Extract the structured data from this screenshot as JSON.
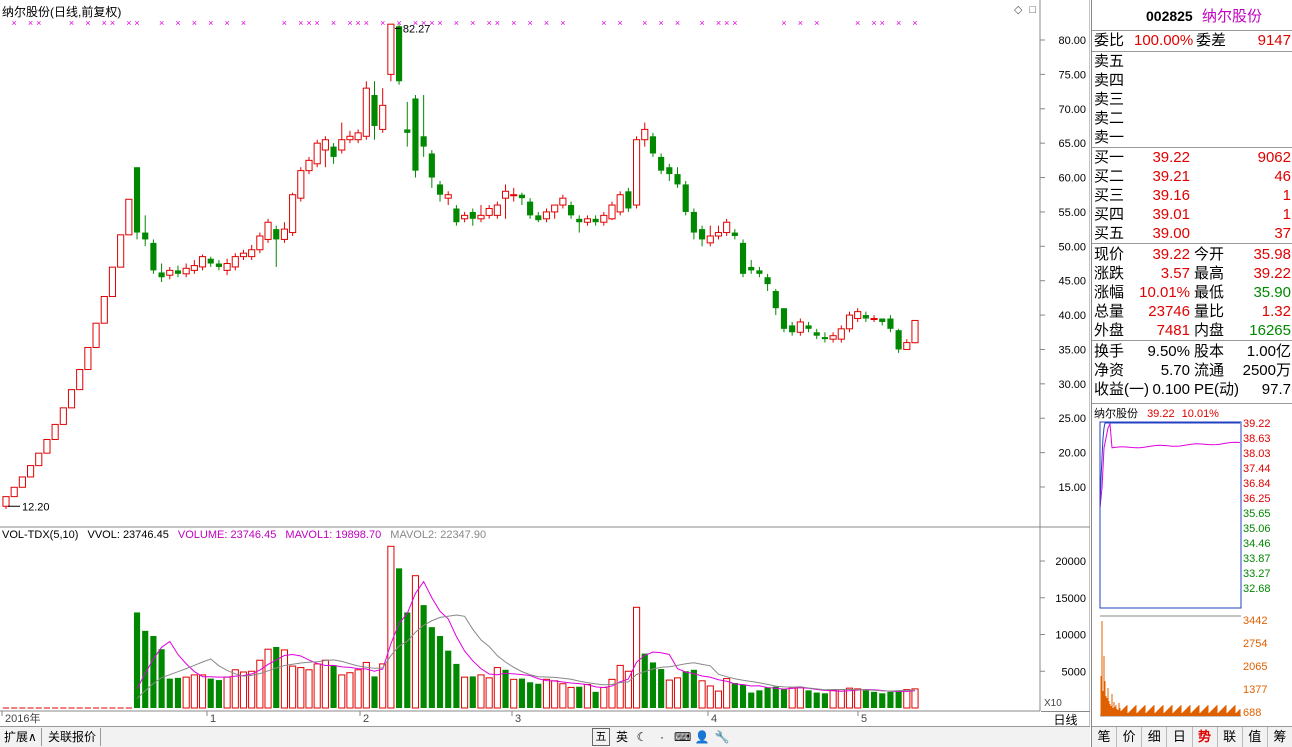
{
  "stock": {
    "code": "002825",
    "name": "纳尔股份",
    "period": "纳尔股份(日线,前复权)"
  },
  "chart_data": {
    "type": "candlestick",
    "y_ticks": [
      "80.00",
      "75.00",
      "70.00",
      "65.00",
      "60.00",
      "55.00",
      "50.00",
      "45.00",
      "40.00",
      "35.00",
      "30.00",
      "25.00",
      "20.00",
      "15.00"
    ],
    "vol_ticks": [
      "20000",
      "15000",
      "10000",
      "5000"
    ],
    "x_labels": [
      "2016年",
      "1",
      "2",
      "3",
      "4",
      "5"
    ],
    "high_label": "82.27",
    "low_label": "12.20",
    "candles": [
      [
        12.2,
        13.6,
        11.8,
        13.6
      ],
      [
        13.6,
        14.96,
        13.6,
        14.96
      ],
      [
        14.96,
        16.46,
        14.96,
        16.46
      ],
      [
        16.46,
        18.11,
        16.46,
        18.11
      ],
      [
        18.11,
        19.92,
        18.11,
        19.92
      ],
      [
        19.92,
        21.91,
        19.92,
        21.91
      ],
      [
        21.91,
        24.1,
        21.91,
        24.1
      ],
      [
        24.1,
        26.51,
        24.1,
        26.51
      ],
      [
        26.51,
        29.16,
        26.51,
        29.16
      ],
      [
        29.16,
        32.08,
        29.16,
        32.08
      ],
      [
        32.08,
        35.29,
        32.08,
        35.29
      ],
      [
        35.29,
        38.82,
        35.29,
        38.82
      ],
      [
        38.82,
        42.7,
        38.82,
        42.7
      ],
      [
        42.7,
        46.97,
        42.7,
        46.97
      ],
      [
        46.97,
        51.67,
        46.97,
        51.67
      ],
      [
        51.67,
        56.84,
        51.67,
        56.84
      ],
      [
        61.5,
        52.0,
        51.0,
        61.5
      ],
      [
        52.0,
        51.0,
        50.0,
        54.5
      ],
      [
        50.5,
        46.5,
        46.0,
        51.0
      ],
      [
        46.2,
        45.5,
        44.8,
        47.5
      ],
      [
        45.8,
        46.5,
        45.2,
        47.0
      ],
      [
        46.5,
        46.0,
        45.5,
        47.2
      ],
      [
        46.0,
        46.8,
        45.5,
        47.5
      ],
      [
        46.5,
        47.2,
        46.0,
        48.0
      ],
      [
        47.0,
        48.5,
        46.5,
        48.8
      ],
      [
        48.2,
        47.5,
        47.0,
        48.5
      ],
      [
        47.5,
        47.0,
        46.5,
        48.0
      ],
      [
        46.5,
        47.5,
        45.8,
        48.2
      ],
      [
        47.0,
        48.5,
        46.5,
        49.0
      ],
      [
        48.5,
        49.0,
        48.0,
        49.5
      ],
      [
        48.5,
        49.5,
        48.0,
        50.2
      ],
      [
        49.5,
        51.5,
        49.0,
        52.0
      ],
      [
        51.0,
        53.5,
        50.5,
        54.0
      ],
      [
        52.5,
        51.0,
        47.0,
        53.0
      ],
      [
        51.0,
        52.5,
        50.5,
        53.5
      ],
      [
        52.0,
        57.5,
        51.5,
        57.8
      ],
      [
        57.0,
        61.0,
        56.5,
        61.5
      ],
      [
        61.0,
        62.5,
        60.5,
        63.0
      ],
      [
        62.0,
        65.0,
        61.5,
        65.5
      ],
      [
        64.0,
        65.5,
        61.5,
        66.0
      ],
      [
        64.5,
        63.0,
        62.0,
        65.0
      ],
      [
        64.0,
        65.5,
        63.5,
        68.0
      ],
      [
        65.5,
        66.0,
        65.0,
        66.8
      ],
      [
        65.5,
        66.5,
        65.0,
        67.0
      ],
      [
        66.0,
        73.0,
        65.5,
        74.0
      ],
      [
        72.0,
        67.5,
        65.5,
        74.0
      ],
      [
        67.0,
        70.5,
        66.5,
        73.0
      ],
      [
        75.0,
        82.3,
        74.0,
        82.3
      ],
      [
        82.0,
        74.0,
        73.5,
        82.27
      ],
      [
        67.0,
        66.5,
        64.5,
        71.0
      ],
      [
        71.5,
        61.0,
        60.0,
        72.0
      ],
      [
        66.0,
        64.5,
        63.0,
        72.0
      ],
      [
        63.5,
        60.0,
        58.5,
        64.0
      ],
      [
        59.0,
        57.5,
        56.5,
        59.5
      ],
      [
        57.0,
        57.5,
        56.0,
        58.0
      ],
      [
        55.5,
        53.5,
        53.0,
        56.0
      ],
      [
        54.0,
        54.5,
        53.5,
        55.0
      ],
      [
        55.0,
        54.0,
        53.0,
        55.5
      ],
      [
        54.0,
        54.5,
        53.5,
        56.0
      ],
      [
        54.5,
        55.5,
        54.0,
        56.0
      ],
      [
        54.5,
        56.0,
        54.0,
        56.5
      ],
      [
        57.0,
        58.0,
        54.0,
        59.0
      ],
      [
        57.5,
        57.5,
        56.5,
        58.5
      ],
      [
        57.5,
        57.0,
        56.0,
        57.8
      ],
      [
        56.5,
        54.5,
        54.0,
        57.0
      ],
      [
        54.5,
        53.8,
        53.5,
        55.0
      ],
      [
        54.0,
        55.0,
        53.5,
        55.5
      ],
      [
        55.0,
        56.0,
        54.0,
        56.0
      ],
      [
        56.0,
        57.0,
        55.5,
        57.5
      ],
      [
        56.0,
        54.5,
        54.0,
        56.5
      ],
      [
        54.0,
        53.5,
        52.0,
        54.5
      ],
      [
        53.5,
        54.0,
        53.0,
        54.5
      ],
      [
        54.0,
        53.5,
        53.0,
        54.5
      ],
      [
        53.5,
        54.5,
        53.0,
        55.0
      ],
      [
        54.0,
        56.0,
        53.8,
        56.5
      ],
      [
        55.0,
        57.5,
        54.5,
        58.0
      ],
      [
        58.0,
        55.5,
        55.0,
        58.5
      ],
      [
        56.0,
        65.5,
        55.5,
        66.0
      ],
      [
        65.5,
        67.0,
        64.5,
        68.0
      ],
      [
        66.0,
        63.5,
        63.0,
        66.5
      ],
      [
        63.0,
        61.0,
        60.5,
        63.5
      ],
      [
        61.5,
        60.5,
        59.5,
        62.0
      ],
      [
        60.5,
        59.0,
        58.5,
        61.5
      ],
      [
        59.0,
        55.0,
        54.5,
        59.5
      ],
      [
        55.0,
        52.0,
        51.0,
        55.5
      ],
      [
        52.5,
        51.0,
        50.0,
        53.0
      ],
      [
        50.5,
        51.5,
        50.0,
        53.0
      ],
      [
        51.5,
        52.0,
        51.0,
        53.0
      ],
      [
        52.0,
        53.5,
        51.5,
        54.0
      ],
      [
        52.0,
        51.5,
        51.0,
        52.5
      ],
      [
        50.5,
        46.0,
        45.5,
        51.0
      ],
      [
        47.0,
        46.5,
        46.0,
        48.0
      ],
      [
        46.5,
        46.0,
        45.5,
        47.0
      ],
      [
        45.5,
        44.5,
        43.5,
        46.0
      ],
      [
        43.5,
        41.0,
        40.0,
        43.8
      ],
      [
        41.0,
        38.0,
        37.5,
        41.0
      ],
      [
        38.5,
        37.5,
        37.0,
        39.0
      ],
      [
        37.5,
        39.0,
        37.0,
        39.5
      ],
      [
        38.5,
        38.0,
        37.5,
        39.0
      ],
      [
        37.5,
        37.0,
        36.5,
        38.0
      ],
      [
        36.8,
        36.5,
        36.0,
        37.5
      ],
      [
        36.5,
        37.0,
        36.0,
        37.5
      ],
      [
        36.5,
        38.0,
        36.0,
        38.5
      ],
      [
        38.0,
        40.0,
        37.5,
        40.5
      ],
      [
        39.5,
        40.5,
        39.0,
        41.0
      ],
      [
        40.0,
        39.5,
        39.0,
        40.5
      ],
      [
        39.5,
        39.5,
        39.0,
        40.0
      ],
      [
        39.5,
        39.0,
        38.5,
        39.5
      ],
      [
        39.5,
        38.0,
        37.5,
        40.0
      ],
      [
        37.8,
        35.0,
        34.5,
        38.0
      ],
      [
        35.0,
        36.0,
        35.0,
        36.5
      ],
      [
        35.98,
        39.22,
        35.9,
        39.22
      ]
    ],
    "volumes": [
      [
        0,
        0
      ],
      [
        0,
        0
      ],
      [
        0,
        0
      ],
      [
        0,
        0
      ],
      [
        0,
        0
      ],
      [
        0,
        0
      ],
      [
        0,
        0
      ],
      [
        0,
        0
      ],
      [
        0,
        0
      ],
      [
        0,
        0
      ],
      [
        0,
        0
      ],
      [
        0,
        0
      ],
      [
        0,
        0
      ],
      [
        0,
        0
      ],
      [
        0,
        0
      ],
      [
        0,
        0
      ],
      [
        13000,
        0
      ],
      [
        10500,
        0
      ],
      [
        9800,
        0
      ],
      [
        8000,
        0
      ],
      [
        4000,
        0
      ],
      [
        4100,
        0
      ],
      [
        4200,
        1
      ],
      [
        4500,
        1
      ],
      [
        4500,
        1
      ],
      [
        4000,
        0
      ],
      [
        3800,
        0
      ],
      [
        4200,
        1
      ],
      [
        5200,
        1
      ],
      [
        4900,
        1
      ],
      [
        5000,
        1
      ],
      [
        6500,
        1
      ],
      [
        8000,
        1
      ],
      [
        8300,
        0
      ],
      [
        7900,
        1
      ],
      [
        5700,
        1
      ],
      [
        5500,
        1
      ],
      [
        5200,
        1
      ],
      [
        6000,
        1
      ],
      [
        6500,
        1
      ],
      [
        5800,
        0
      ],
      [
        4500,
        1
      ],
      [
        4800,
        1
      ],
      [
        5200,
        1
      ],
      [
        6200,
        1
      ],
      [
        4300,
        0
      ],
      [
        6000,
        1
      ],
      [
        22000,
        1
      ],
      [
        19000,
        0
      ],
      [
        13000,
        0
      ],
      [
        18000,
        1
      ],
      [
        14000,
        0
      ],
      [
        11000,
        0
      ],
      [
        9800,
        0
      ],
      [
        7800,
        0
      ],
      [
        6000,
        0
      ],
      [
        4200,
        1
      ],
      [
        4300,
        0
      ],
      [
        4500,
        1
      ],
      [
        4100,
        1
      ],
      [
        5500,
        1
      ],
      [
        5200,
        0
      ],
      [
        3900,
        1
      ],
      [
        4000,
        0
      ],
      [
        3500,
        0
      ],
      [
        3300,
        0
      ],
      [
        3900,
        1
      ],
      [
        3700,
        1
      ],
      [
        3300,
        1
      ],
      [
        2800,
        1
      ],
      [
        2900,
        0
      ],
      [
        3200,
        1
      ],
      [
        2200,
        0
      ],
      [
        2800,
        1
      ],
      [
        3900,
        1
      ],
      [
        5800,
        1
      ],
      [
        5000,
        1
      ],
      [
        13700,
        1
      ],
      [
        7400,
        0
      ],
      [
        6200,
        0
      ],
      [
        5300,
        0
      ],
      [
        3800,
        1
      ],
      [
        4100,
        1
      ],
      [
        5000,
        0
      ],
      [
        5200,
        0
      ],
      [
        3700,
        1
      ],
      [
        3000,
        1
      ],
      [
        2300,
        1
      ],
      [
        4000,
        1
      ],
      [
        3400,
        0
      ],
      [
        3200,
        0
      ],
      [
        2100,
        0
      ],
      [
        2400,
        0
      ],
      [
        2800,
        0
      ],
      [
        2900,
        0
      ],
      [
        2600,
        0
      ],
      [
        2700,
        1
      ],
      [
        2800,
        1
      ],
      [
        2400,
        0
      ],
      [
        2100,
        0
      ],
      [
        2000,
        0
      ],
      [
        2400,
        1
      ],
      [
        2500,
        1
      ],
      [
        2700,
        1
      ],
      [
        2600,
        1
      ],
      [
        2400,
        0
      ],
      [
        2200,
        0
      ],
      [
        2000,
        0
      ],
      [
        2200,
        0
      ],
      [
        2400,
        0
      ],
      [
        2500,
        1
      ],
      [
        2600,
        1
      ]
    ],
    "mavol1_label": "MAVOL1: 19898.70",
    "mavol2_label": "MAVOL2: 22347.90"
  },
  "vol_legend": {
    "indicator": "VOL-TDX(5,10)",
    "vvol": "VVOL: 23746.45",
    "volume": "VOLUME: 23746.45",
    "mavol1": "MAVOL1: 19898.70",
    "mavol2": "MAVOL2: 22347.90"
  },
  "x10_label": "X10",
  "period_button": "日线",
  "bottom_tabs": [
    "扩展",
    "关联报价"
  ],
  "quote": {
    "weibi_k": "委比",
    "weibi_v": "100.00%",
    "weicha_k": "委差",
    "weicha_v": "9147",
    "sell": [
      {
        "k": "卖五"
      },
      {
        "k": "卖四"
      },
      {
        "k": "卖三"
      },
      {
        "k": "卖二"
      },
      {
        "k": "卖一"
      }
    ],
    "buy": [
      {
        "k": "买一",
        "p": "39.22",
        "v": "9062"
      },
      {
        "k": "买二",
        "p": "39.21",
        "v": "46"
      },
      {
        "k": "买三",
        "p": "39.16",
        "v": "1"
      },
      {
        "k": "买四",
        "p": "39.01",
        "v": "1"
      },
      {
        "k": "买五",
        "p": "39.00",
        "v": "37"
      }
    ],
    "stats": [
      {
        "k1": "现价",
        "v1": "39.22",
        "k2": "今开",
        "v2": "35.98"
      },
      {
        "k1": "涨跌",
        "v1": "3.57",
        "k2": "最高",
        "v2": "39.22"
      },
      {
        "k1": "涨幅",
        "v1": "10.01%",
        "k2": "最低",
        "v2": "35.90"
      },
      {
        "k1": "总量",
        "v1": "23746",
        "k2": "量比",
        "v2": "1.32"
      },
      {
        "k1": "外盘",
        "v1": "7481",
        "k2": "内盘",
        "v2": "16265"
      }
    ],
    "fin": [
      {
        "k1": "换手",
        "v1": "9.50%",
        "k2": "股本",
        "v2": "1.00亿"
      },
      {
        "k1": "净资",
        "v1": "5.70",
        "k2": "流通",
        "v2": "2500万"
      },
      {
        "k1": "收益(一)",
        "v1": "0.100",
        "k2": "PE(动)",
        "v2": "97.7"
      }
    ]
  },
  "mini": {
    "name": "纳尔股份",
    "price": "39.22",
    "pct": "10.01%",
    "left_ticks": [
      "39.22",
      "38.63",
      "38.03",
      "37.44",
      "36.84",
      "36.25",
      "35.65",
      "35.06",
      "34.46",
      "33.87",
      "33.27",
      "32.68"
    ],
    "vol_ticks": [
      "3442",
      "2754",
      "2065",
      "1377",
      "688"
    ]
  },
  "rp_tabs": [
    "笔",
    "价",
    "细",
    "日",
    "势",
    "联",
    "值",
    "筹"
  ],
  "rp_active": "势"
}
